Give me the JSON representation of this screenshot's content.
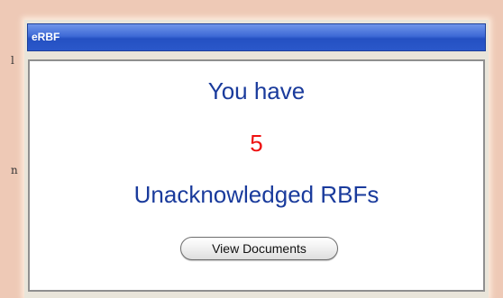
{
  "widget": {
    "title": "eRBF",
    "headline": "You have",
    "count": "5",
    "subject": "Unacknowledged RBFs",
    "button_label": "View Documents"
  },
  "edge_fragments": [
    "l",
    "n"
  ],
  "colors": {
    "page_background": "#eec9b6",
    "titlebar_blue": "#2b58ca",
    "message_text": "#1a3b9c",
    "count_text": "#ee1111"
  }
}
